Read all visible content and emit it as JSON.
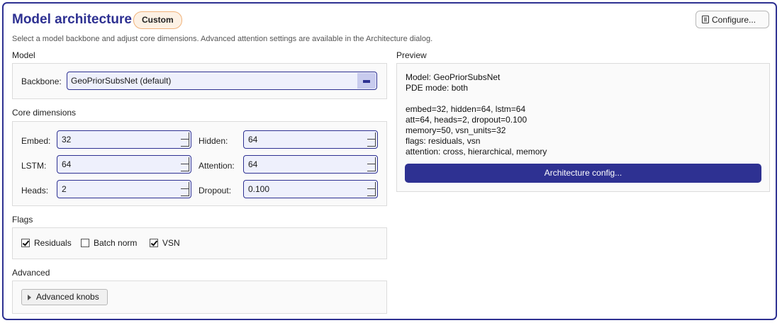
{
  "header": {
    "title": "Model architecture",
    "badge": "Custom",
    "configure_label": "Configure...",
    "subtitle": "Select a model backbone and adjust core dimensions. Advanced attention settings are available in the Architecture dialog."
  },
  "model": {
    "section_label": "Model",
    "backbone_label": "Backbone:",
    "backbone_value": "GeoPriorSubsNet (default)"
  },
  "core": {
    "section_label": "Core dimensions",
    "embed": {
      "label": "Embed:",
      "value": "32"
    },
    "hidden": {
      "label": "Hidden:",
      "value": "64"
    },
    "lstm": {
      "label": "LSTM:",
      "value": "64"
    },
    "attention": {
      "label": "Attention:",
      "value": "64"
    },
    "heads": {
      "label": "Heads:",
      "value": "2"
    },
    "dropout": {
      "label": "Dropout:",
      "value": "0.100"
    }
  },
  "flags": {
    "section_label": "Flags",
    "items": [
      {
        "label": "Residuals",
        "checked": true
      },
      {
        "label": "Batch norm",
        "checked": false
      },
      {
        "label": "VSN",
        "checked": true
      }
    ]
  },
  "advanced": {
    "section_label": "Advanced",
    "knobs_label": "Advanced knobs"
  },
  "preview": {
    "section_label": "Preview",
    "lines": [
      "Model: GeoPriorSubsNet",
      "PDE mode: both",
      "",
      "embed=32, hidden=64, lstm=64",
      "att=64, heads=2, dropout=0.100",
      "memory=50, vsn_units=32",
      "flags: residuals, vsn",
      "attention: cross, hierarchical, memory"
    ],
    "arch_button_label": "Architecture config..."
  },
  "colors": {
    "accent": "#2e3192",
    "badge_bg": "#fdf1e4",
    "badge_border": "#f0b27a",
    "input_bg": "#eef0fc"
  }
}
